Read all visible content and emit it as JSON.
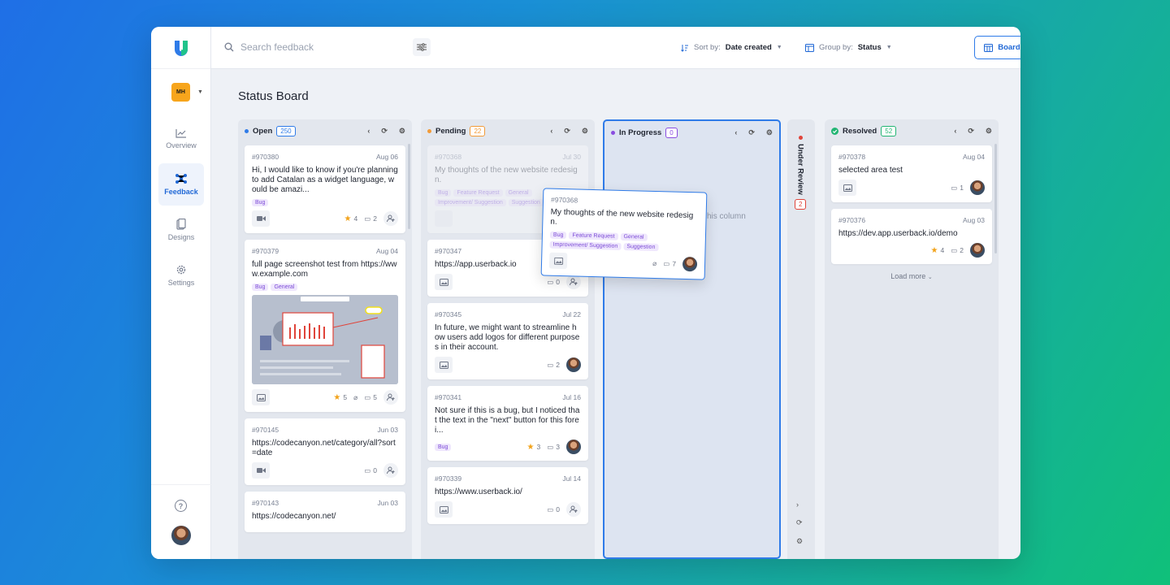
{
  "header": {
    "search_placeholder": "Search feedback",
    "sort_label": "Sort by:",
    "sort_value": "Date created",
    "group_label": "Group by:",
    "group_value": "Status",
    "view_label": "Board View"
  },
  "sidebar": {
    "workspace_badge": "MH",
    "items": [
      {
        "label": "Overview",
        "icon": "chart-line-icon"
      },
      {
        "label": "Feedback",
        "icon": "feedback-nodes-icon"
      },
      {
        "label": "Designs",
        "icon": "designs-icon"
      },
      {
        "label": "Settings",
        "icon": "gear-icon"
      }
    ],
    "help": "?"
  },
  "page": {
    "title": "Status Board"
  },
  "columns": {
    "open": {
      "name": "Open",
      "count": "250",
      "color": "#2f7be8",
      "cards": [
        {
          "id": "#970380",
          "date": "Aug 06",
          "title": "Hi, I would like to know if you're planning to add Catalan as a widget language, would be amazi...",
          "tags": [
            "Bug"
          ],
          "media": "video",
          "stars": "4",
          "comments": "2"
        },
        {
          "id": "#970379",
          "date": "Aug 04",
          "title": "full page screenshot test from https://www.example.com",
          "tags": [
            "Bug",
            "General"
          ],
          "media": "image",
          "stars": "5",
          "comments": "5"
        },
        {
          "id": "#970145",
          "date": "Jun 03",
          "title": "https://codecanyon.net/category/all?sort=date",
          "tags": [],
          "media": "video",
          "comments": "0"
        },
        {
          "id": "#970143",
          "date": "Jun 03",
          "title": "https://codecanyon.net/"
        }
      ]
    },
    "pending": {
      "name": "Pending",
      "count": "22",
      "color": "#f29b38",
      "cards": [
        {
          "id": "#970368",
          "date": "Jul 30",
          "title": "My thoughts of the new website redesign.",
          "tags": [
            "Bug",
            "Feature Request",
            "General",
            "Improvement/ Suggestion",
            "Suggestion"
          ]
        },
        {
          "id": "#970347",
          "date": "",
          "title": "https://app.userback.io",
          "comments": "0"
        },
        {
          "id": "#970345",
          "date": "Jul 22",
          "title": "In future, we might want to streamline how users add logos for different purposes in their account.",
          "comments": "2"
        },
        {
          "id": "#970341",
          "date": "Jul 16",
          "title": "Not sure if this is a bug, but I noticed that the text in the \"next\" button for this forei...",
          "tags": [
            "Bug"
          ],
          "stars": "3",
          "comments": "3"
        },
        {
          "id": "#970339",
          "date": "Jul 14",
          "title": "https://www.userback.io/",
          "comments": "0"
        }
      ]
    },
    "inprogress": {
      "name": "In Progress",
      "count": "0",
      "color": "#8a4de0",
      "drop_hint": "his column"
    },
    "underreview": {
      "name": "Under Review",
      "count": "2",
      "color": "#e0443a"
    },
    "resolved": {
      "name": "Resolved",
      "count": "52",
      "color": "#22b573",
      "cards": [
        {
          "id": "#970378",
          "date": "Aug 04",
          "title": "selected area test",
          "comments": "1"
        },
        {
          "id": "#970376",
          "date": "Aug 03",
          "title": "https://dev.app.userback.io/demo",
          "stars": "4",
          "comments": "2"
        }
      ],
      "load_more": "Load more"
    }
  },
  "dragging_card": {
    "id": "#970368",
    "title": "My thoughts of the new website redesign.",
    "tags": [
      "Bug",
      "Feature Request",
      "General",
      "Improvement/ Suggestion",
      "Suggestion"
    ],
    "comments": "7"
  }
}
